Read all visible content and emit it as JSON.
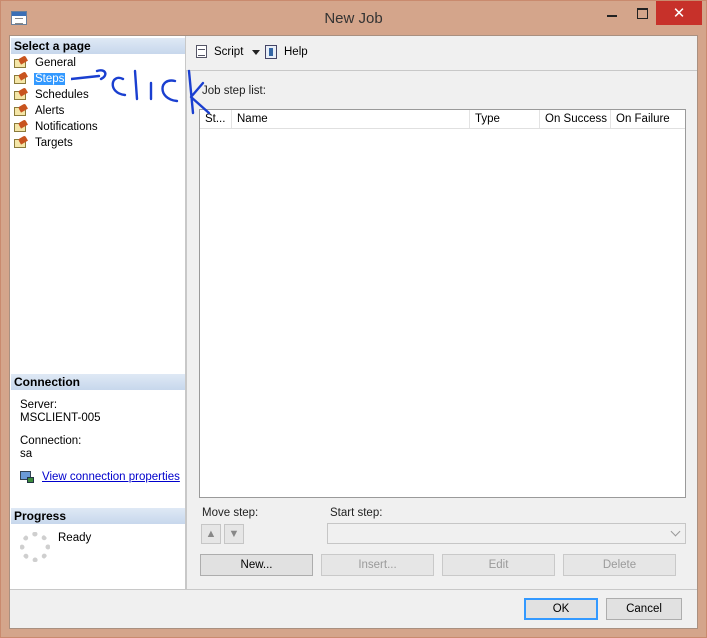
{
  "window": {
    "title": "New Job"
  },
  "left_panel": {
    "select_header": "Select a page",
    "pages": [
      {
        "label": "General"
      },
      {
        "label": "Steps"
      },
      {
        "label": "Schedules"
      },
      {
        "label": "Alerts"
      },
      {
        "label": "Notifications"
      },
      {
        "label": "Targets"
      }
    ],
    "selected_page": "Steps",
    "connection_header": "Connection",
    "server_label": "Server:",
    "server_value": "MSCLIENT-005",
    "connection_label": "Connection:",
    "connection_value": "sa",
    "view_connection_link": "View connection properties",
    "progress_header": "Progress",
    "progress_status": "Ready"
  },
  "toolbar": {
    "script_label": "Script",
    "help_label": "Help"
  },
  "steps_panel": {
    "list_label": "Job step list:",
    "columns": [
      "St...",
      "Name",
      "Type",
      "On Success",
      "On Failure"
    ],
    "move_step_label": "Move step:",
    "start_step_label": "Start step:",
    "start_step_value": "",
    "buttons": {
      "new": "New...",
      "insert": "Insert...",
      "edit": "Edit",
      "delete": "Delete"
    }
  },
  "dialog_buttons": {
    "ok": "OK",
    "cancel": "Cancel"
  },
  "annotation": {
    "text": "click",
    "color": "#1a3fd0"
  },
  "colors": {
    "titlebar": "#d4a58b",
    "close": "#c7312a",
    "selection": "#3399ff",
    "link": "#0000cc"
  }
}
